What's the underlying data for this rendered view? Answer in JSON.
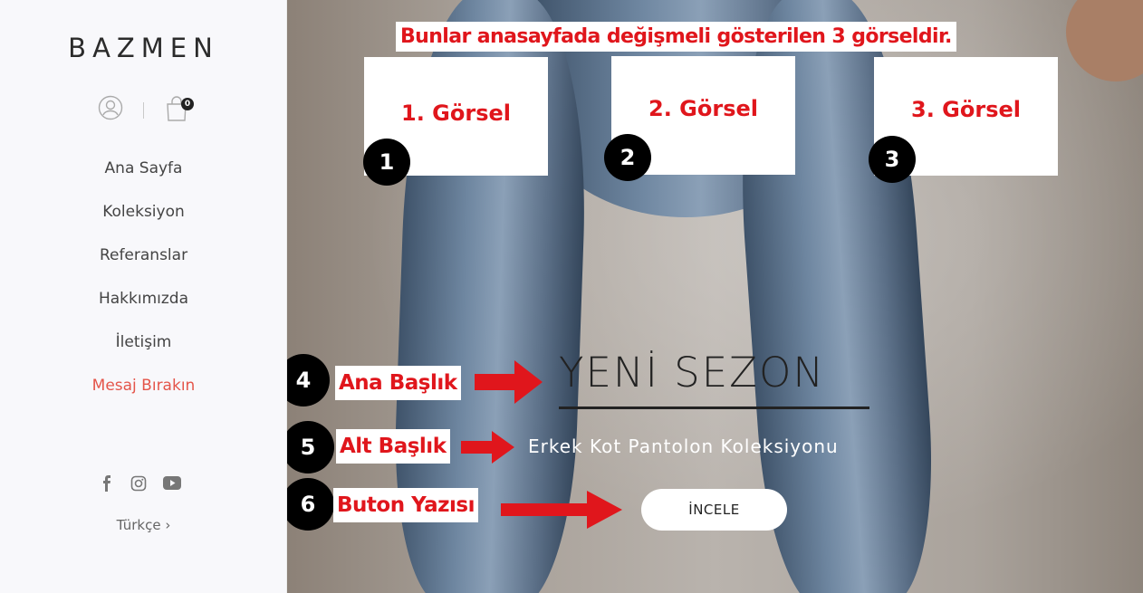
{
  "sidebar": {
    "logo": "BAZMEN",
    "cart_count": "0",
    "menu": [
      {
        "label": "Ana Sayfa"
      },
      {
        "label": "Koleksiyon"
      },
      {
        "label": "Referanslar"
      },
      {
        "label": "Hakkımızda"
      },
      {
        "label": "İletişim"
      },
      {
        "label": "Mesaj Bırakın"
      }
    ],
    "social_icons": [
      "facebook-icon",
      "instagram-icon",
      "youtube-icon"
    ],
    "language": "Türkçe ›"
  },
  "hero": {
    "headline": "YENİ SEZON",
    "subheadline": "Erkek Kot Pantolon Koleksiyonu",
    "button_label": "İNCELE"
  },
  "annotations": {
    "title": "Bunlar anasayfada değişmeli gösterilen 3 görseldir.",
    "boxes": [
      {
        "label": "1. Görsel",
        "number": "1"
      },
      {
        "label": "2. Görsel",
        "number": "2"
      },
      {
        "label": "3. Görsel",
        "number": "3"
      }
    ],
    "tags": [
      {
        "number": "4",
        "label": "Ana Başlık"
      },
      {
        "number": "5",
        "label": "Alt Başlık"
      },
      {
        "number": "6",
        "label": "Buton Yazısı"
      }
    ],
    "colors": {
      "accent_red": "#e0161c",
      "menu_accent": "#e4554a"
    }
  }
}
